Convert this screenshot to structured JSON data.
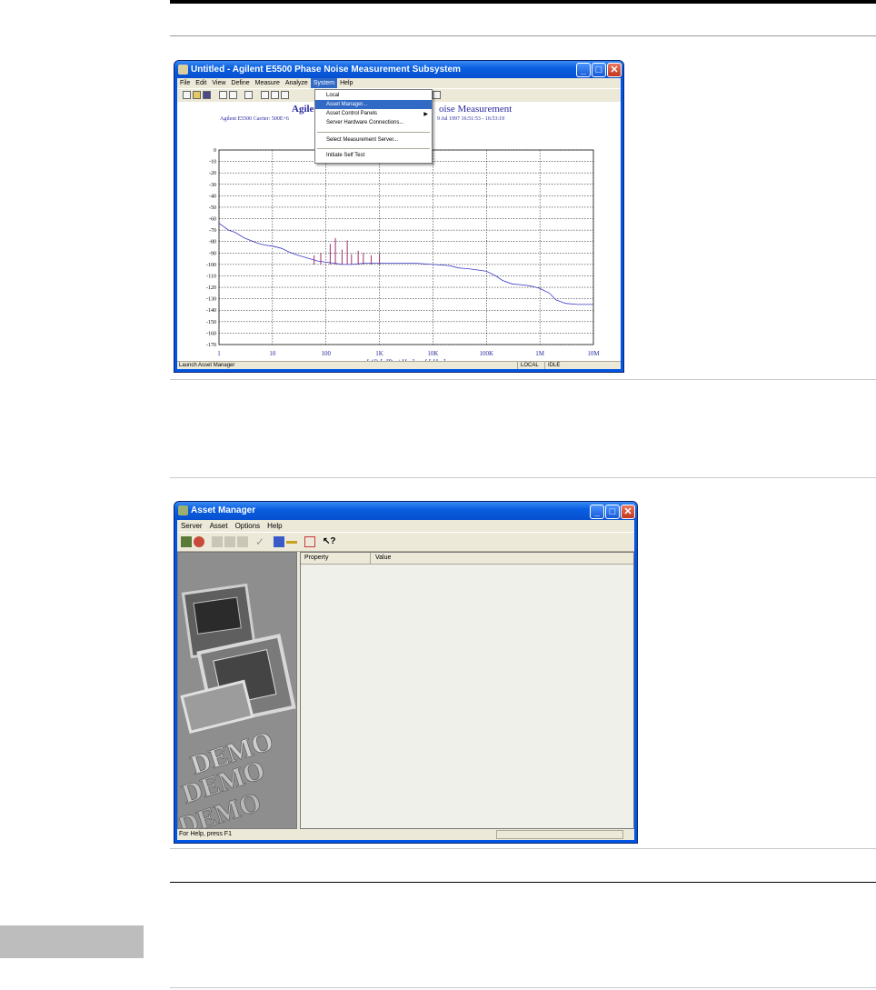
{
  "win1": {
    "title": "Untitled - Agilent E5500 Phase Noise Measurement Subsystem",
    "menu": [
      "File",
      "Edit",
      "View",
      "Define",
      "Measure",
      "Analyze",
      "System",
      "Help"
    ],
    "system_menu": {
      "items": [
        "Local",
        "Asset Manager...",
        "Asset Control Panels",
        "Server Hardware Connections...",
        "Select Measurement Server...",
        "Initiate Self Test"
      ]
    },
    "status": {
      "left": "Launch Asset Manager",
      "local": "LOCAL",
      "state": "IDLE"
    }
  },
  "chart_data": {
    "type": "line",
    "title_left": "Agilent",
    "title_right": "oise Measurement",
    "subtitle_left": "Agilent E5500   Carrier: 500E+6",
    "subtitle_right": "9 Jul 1997  16:51:53 - 16:53:19",
    "xlabel": "L(f)  [ dBc / Hz ]  vs  f  [ Hz ]",
    "x_scale": "log",
    "xlim": [
      1,
      10000000
    ],
    "ylim": [
      -170,
      0
    ],
    "x_ticks": [
      "1",
      "10",
      "100",
      "1K",
      "10K",
      "100K",
      "1M",
      "10M"
    ],
    "y_ticks": [
      "0",
      "-10",
      "-20",
      "-30",
      "-40",
      "-50",
      "-60",
      "-70",
      "-80",
      "-90",
      "-100",
      "-110",
      "-120",
      "-130",
      "-140",
      "-150",
      "-160",
      "-170"
    ],
    "grid": true,
    "colors": {
      "trace": "#3a3ac8",
      "spurs": "#a0306a",
      "grid": "#000000",
      "text": "#2a2aa0"
    },
    "series": [
      {
        "x": [
          1,
          1.5,
          2,
          3,
          5,
          7,
          10,
          15,
          20,
          30,
          50,
          70,
          100,
          150,
          200,
          300,
          500,
          700,
          1000,
          2000,
          3000,
          5000,
          10000,
          20000,
          30000,
          50000,
          100000,
          150000,
          200000,
          300000,
          500000,
          700000,
          1000000,
          1500000,
          2000000,
          3000000,
          5000000,
          10000000
        ],
        "y": [
          -64,
          -70,
          -72,
          -77,
          -81,
          -83,
          -84,
          -86,
          -89,
          -92,
          -95,
          -97,
          -98,
          -99,
          -100,
          -100,
          -99,
          -99,
          -99,
          -99,
          -99,
          -99,
          -100,
          -101,
          -103,
          -104,
          -106,
          -110,
          -114,
          -117,
          -118,
          -119,
          -121,
          -125,
          -131,
          -134,
          -135,
          -135
        ]
      }
    ],
    "spurs": [
      {
        "x": 60,
        "y": -92
      },
      {
        "x": 80,
        "y": -90
      },
      {
        "x": 120,
        "y": -82
      },
      {
        "x": 150,
        "y": -77
      },
      {
        "x": 200,
        "y": -87
      },
      {
        "x": 250,
        "y": -79
      },
      {
        "x": 300,
        "y": -91
      },
      {
        "x": 400,
        "y": -88
      },
      {
        "x": 500,
        "y": -90
      },
      {
        "x": 700,
        "y": -92
      },
      {
        "x": 1000,
        "y": -90
      }
    ]
  },
  "win2": {
    "title": "Asset Manager",
    "menu": [
      "Server",
      "Asset",
      "Options",
      "Help"
    ],
    "columns": [
      "Property",
      "Value"
    ],
    "demo_words": [
      "DEMO",
      "DEMO",
      "DEMO"
    ],
    "status": "For Help, press F1"
  }
}
